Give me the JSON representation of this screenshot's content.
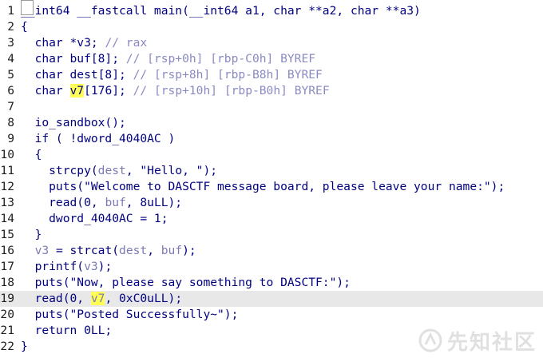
{
  "editor": {
    "lines": [
      {
        "n": "1",
        "code": [
          {
            "t": "__int64 __fastcall main(__int64 a1, char **a2, char **a3)",
            "c": ""
          }
        ]
      },
      {
        "n": "2",
        "code": [
          {
            "t": "{",
            "c": ""
          }
        ]
      },
      {
        "n": "3",
        "code": [
          {
            "t": "  char *v3; ",
            "c": ""
          },
          {
            "t": "// rax",
            "c": "tok-comment"
          }
        ]
      },
      {
        "n": "4",
        "code": [
          {
            "t": "  char buf[8]; ",
            "c": ""
          },
          {
            "t": "// [rsp+0h] [rbp-C0h] BYREF",
            "c": "tok-comment"
          }
        ]
      },
      {
        "n": "5",
        "code": [
          {
            "t": "  char dest[8]; ",
            "c": ""
          },
          {
            "t": "// [rsp+8h] [rbp-B8h] BYREF",
            "c": "tok-comment"
          }
        ]
      },
      {
        "n": "6",
        "code": [
          {
            "t": "  char ",
            "c": ""
          },
          {
            "t": "v7",
            "c": "tok-hl"
          },
          {
            "t": "[176]; ",
            "c": ""
          },
          {
            "t": "// [rsp+10h] [rbp-B0h] BYREF",
            "c": "tok-comment"
          }
        ]
      },
      {
        "n": "7",
        "code": [
          {
            "t": "",
            "c": ""
          }
        ]
      },
      {
        "n": "8",
        "code": [
          {
            "t": "  io_sandbox();",
            "c": ""
          }
        ]
      },
      {
        "n": "9",
        "code": [
          {
            "t": "  if ( !dword_4040AC )",
            "c": ""
          }
        ]
      },
      {
        "n": "10",
        "code": [
          {
            "t": "  {",
            "c": ""
          }
        ]
      },
      {
        "n": "11",
        "code": [
          {
            "t": "    strcpy(",
            "c": ""
          },
          {
            "t": "dest",
            "c": "tok-dim"
          },
          {
            "t": ", \"Hello, \");",
            "c": ""
          }
        ]
      },
      {
        "n": "12",
        "code": [
          {
            "t": "    puts(\"Welcome to DASCTF message board, please leave your name:\");",
            "c": ""
          }
        ]
      },
      {
        "n": "13",
        "code": [
          {
            "t": "    read(0, ",
            "c": ""
          },
          {
            "t": "buf",
            "c": "tok-dim"
          },
          {
            "t": ", 8uLL);",
            "c": ""
          }
        ]
      },
      {
        "n": "14",
        "code": [
          {
            "t": "    dword_4040AC = 1;",
            "c": ""
          }
        ]
      },
      {
        "n": "15",
        "code": [
          {
            "t": "  }",
            "c": ""
          }
        ]
      },
      {
        "n": "16",
        "code": [
          {
            "t": "  ",
            "c": ""
          },
          {
            "t": "v3",
            "c": "tok-dim"
          },
          {
            "t": " = strcat(",
            "c": ""
          },
          {
            "t": "dest",
            "c": "tok-dim"
          },
          {
            "t": ", ",
            "c": ""
          },
          {
            "t": "buf",
            "c": "tok-dim"
          },
          {
            "t": ");",
            "c": ""
          }
        ]
      },
      {
        "n": "17",
        "code": [
          {
            "t": "  printf(",
            "c": ""
          },
          {
            "t": "v3",
            "c": "tok-dim"
          },
          {
            "t": ");",
            "c": ""
          }
        ]
      },
      {
        "n": "18",
        "code": [
          {
            "t": "  puts(\"Now, please say something to DASCTF:\");",
            "c": ""
          }
        ]
      },
      {
        "n": "19",
        "code": [
          {
            "t": "  read(0, ",
            "c": ""
          },
          {
            "t": "v7",
            "c": "tok-hl tok-dim"
          },
          {
            "t": ", 0xC0uLL);",
            "c": ""
          }
        ]
      },
      {
        "n": "20",
        "code": [
          {
            "t": "  puts(\"Posted Successfully~\");",
            "c": ""
          }
        ]
      },
      {
        "n": "21",
        "code": [
          {
            "t": "  return 0LL;",
            "c": ""
          }
        ]
      },
      {
        "n": "22",
        "code": [
          {
            "t": "}",
            "c": ""
          }
        ]
      }
    ],
    "current_line": "19",
    "colors": {
      "code_text": "#000080",
      "dim_variable": "#7b7bb3",
      "comment": "#8a8ac2",
      "highlight": "#ffff55",
      "current_line_bg": "#e8e8e8"
    }
  },
  "watermark": {
    "text": "先知社区"
  }
}
